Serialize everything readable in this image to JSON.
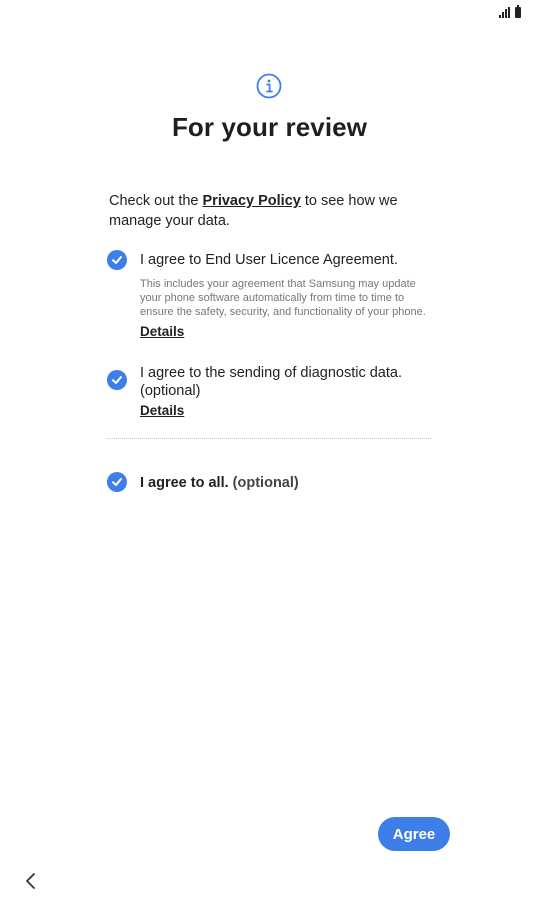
{
  "header": {
    "icon": "info-icon",
    "title": "For your review"
  },
  "intro": {
    "prefix": "Check out the ",
    "link": "Privacy Policy",
    "suffix": " to see how we manage your data."
  },
  "agreements": [
    {
      "label": "I agree to End User Licence Agreement.",
      "checked": true,
      "description": "This includes your agreement that Samsung may update your phone software automatically from time to time to ensure the safety, security, and functionality of your phone.",
      "details_label": "Details"
    },
    {
      "label": "I agree to the sending of diagnostic data. (optional)",
      "checked": true,
      "details_label": "Details"
    }
  ],
  "agree_all": {
    "label": "I agree to all.",
    "suffix": " (optional)",
    "checked": true
  },
  "footer": {
    "agree_label": "Agree",
    "back_icon": "chevron-left-icon"
  },
  "colors": {
    "accent": "#3e7ee8"
  }
}
